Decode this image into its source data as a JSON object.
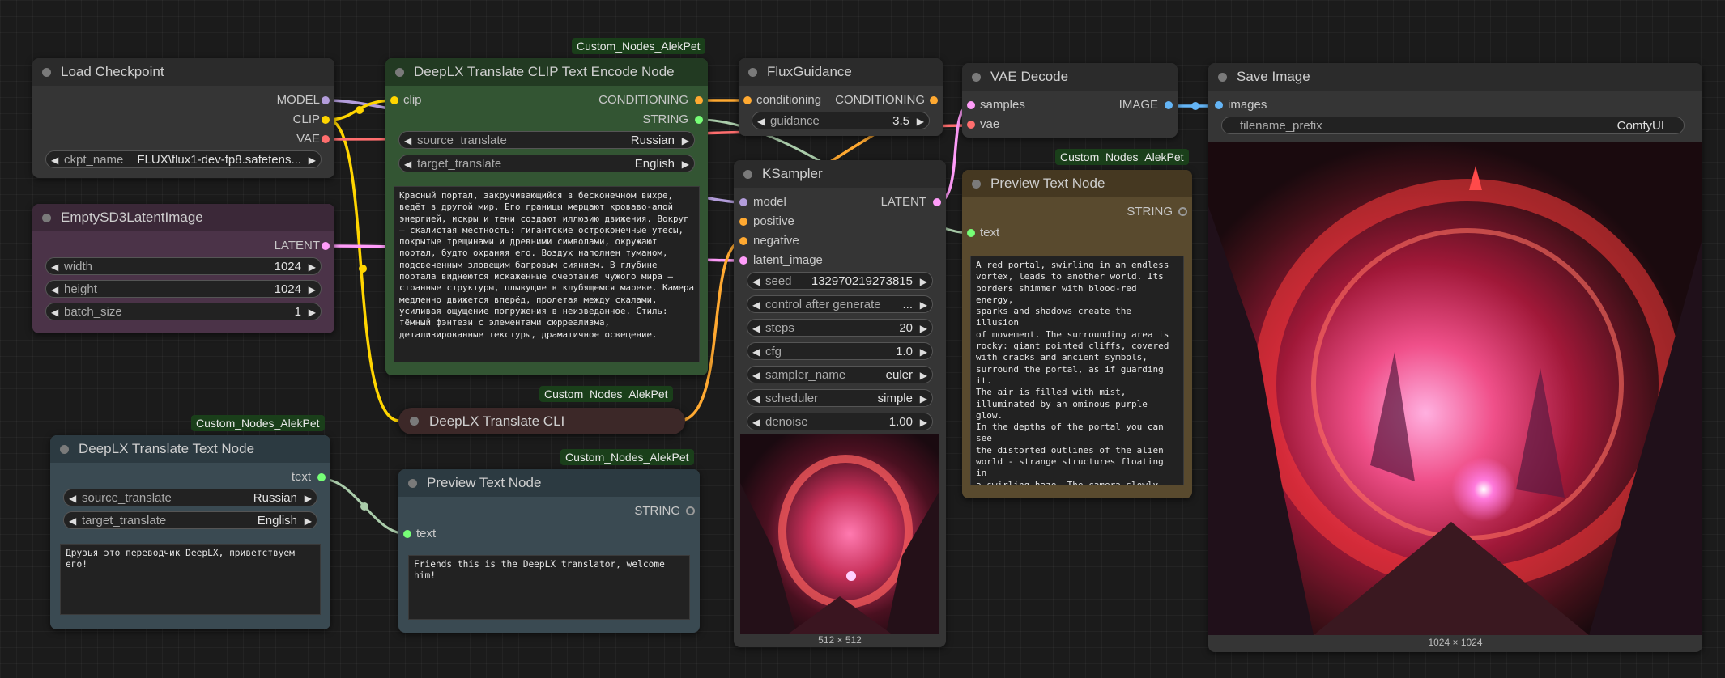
{
  "badges": {
    "clip_encode": "Custom_Nodes_AlekPet",
    "translate_cli": "Custom_Nodes_AlekPet",
    "translate_text": "Custom_Nodes_AlekPet",
    "preview_text_bottom": "Custom_Nodes_AlekPet",
    "preview_text_right": "Custom_Nodes_AlekPet"
  },
  "load_checkpoint": {
    "title": "Load Checkpoint",
    "outputs": [
      "MODEL",
      "CLIP",
      "VAE"
    ],
    "ckpt_label": "ckpt_name",
    "ckpt_value": "FLUX\\flux1-dev-fp8.safetens..."
  },
  "latent_image": {
    "title": "EmptySD3LatentImage",
    "output": "LATENT",
    "widgets": [
      {
        "label": "width",
        "value": "1024"
      },
      {
        "label": "height",
        "value": "1024"
      },
      {
        "label": "batch_size",
        "value": "1"
      }
    ]
  },
  "clip_encode": {
    "title": "DeepLX Translate CLIP Text Encode Node",
    "input": "clip",
    "outputs": [
      "CONDITIONING",
      "STRING"
    ],
    "widgets": [
      {
        "label": "source_translate",
        "value": "Russian"
      },
      {
        "label": "target_translate",
        "value": "English"
      }
    ],
    "text": "Красный портал, закручивающийся в бесконечном вихре,\nведёт в другой мир. Его границы мерцают кроваво-алой\nэнергией, искры и тени создают иллюзию движения. Вокруг\n— скалистая местность: гигантские остроконечные утёсы,\nпокрытые трещинами и древними символами, окружают\nпортал, будто охраняя его. Воздух наполнен туманом,\nподсвеченным зловещим багровым сиянием. В глубине\nпортала виднеются искажённые очертания чужого мира —\nстранные структуры, плывущие в клубящемся мареве. Камера\nмедленно движется вперёд, пролетая между скалами,\nусиливая ощущение погружения в неизведанное. Стиль:\nтёмный фэнтези с элементами сюрреализма,\nдетализированные текстуры, драматичное освещение."
  },
  "translate_cli": {
    "title": "DeepLX Translate CLI"
  },
  "translate_text": {
    "title": "DeepLX Translate Text Node",
    "output": "text",
    "widgets": [
      {
        "label": "source_translate",
        "value": "Russian"
      },
      {
        "label": "target_translate",
        "value": "English"
      }
    ],
    "text": "Друзья это переводчик DeepLX, приветствуем его!"
  },
  "preview_text_bottom": {
    "title": "Preview Text Node",
    "output": "STRING",
    "input": "text",
    "text": "Friends this is the DeepLX translator, welcome him!"
  },
  "flux_guidance": {
    "title": "FluxGuidance",
    "input": "conditioning",
    "output": "CONDITIONING",
    "widget": {
      "label": "guidance",
      "value": "3.5"
    }
  },
  "ksampler": {
    "title": "KSampler",
    "inputs": [
      "model",
      "positive",
      "negative",
      "latent_image"
    ],
    "output": "LATENT",
    "widgets": [
      {
        "label": "seed",
        "value": "132970219273815"
      },
      {
        "label": "control after generate",
        "value": "..."
      },
      {
        "label": "steps",
        "value": "20"
      },
      {
        "label": "cfg",
        "value": "1.0"
      },
      {
        "label": "sampler_name",
        "value": "euler"
      },
      {
        "label": "scheduler",
        "value": "simple"
      },
      {
        "label": "denoise",
        "value": "1.00"
      }
    ],
    "image_size": "512 × 512"
  },
  "vae_decode": {
    "title": "VAE Decode",
    "inputs": [
      "samples",
      "vae"
    ],
    "output": "IMAGE"
  },
  "preview_text_right": {
    "title": "Preview Text Node",
    "output": "STRING",
    "input": "text",
    "text": "A red portal, swirling in an endless\nvortex, leads to another world. Its\nborders shimmer with blood-red energy,\nsparks and shadows create the illusion\nof movement. The surrounding area is\nrocky: giant pointed cliffs, covered\nwith cracks and ancient symbols,\nsurround the portal, as if guarding it.\nThe air is filled with mist,\nilluminated by an ominous purple glow.\nIn the depths of the portal you can see\nthe distorted outlines of the alien\nworld - strange structures floating in\na swirling haze. The camera slowly\nmoves forward, flying between the\ncliffs, increasing the sense of\nimmersion."
  },
  "save_image": {
    "title": "Save Image",
    "input": "images",
    "widget": {
      "label": "filename_prefix",
      "value": "ComfyUI"
    },
    "image_size": "1024 × 1024"
  },
  "colors": {
    "model": "#b39ddb",
    "clip": "#ffd500",
    "vae": "#ff6e6e",
    "latent": "#ff9cf9",
    "conditioning": "#ffa931",
    "string": "#77ff77",
    "image": "#64b5f6"
  }
}
